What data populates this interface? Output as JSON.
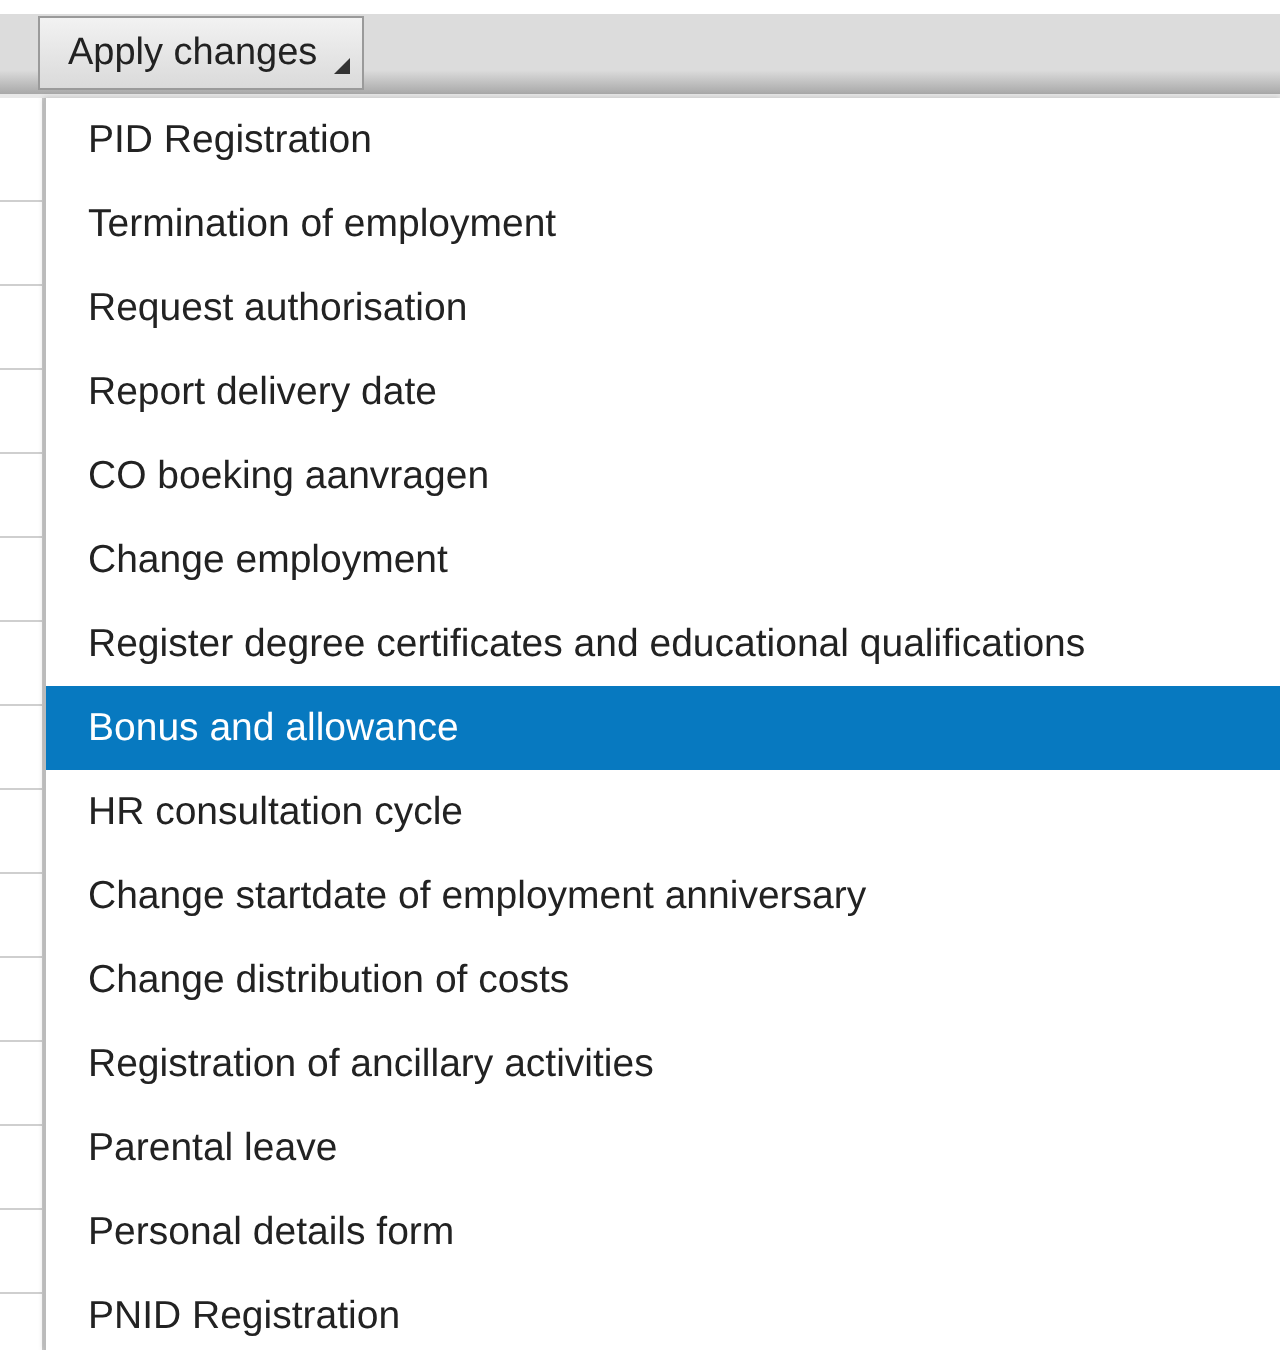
{
  "toolbar": {
    "button": {
      "label": "Apply changes"
    }
  },
  "menu": {
    "items": [
      {
        "label": "PID Registration",
        "selected": false
      },
      {
        "label": "Termination of employment",
        "selected": false
      },
      {
        "label": "Request authorisation",
        "selected": false
      },
      {
        "label": "Report delivery date",
        "selected": false
      },
      {
        "label": "CO boeking aanvragen",
        "selected": false
      },
      {
        "label": "Change employment",
        "selected": false
      },
      {
        "label": "Register degree certificates and educational qualifications",
        "selected": false
      },
      {
        "label": "Bonus and allowance",
        "selected": true
      },
      {
        "label": "HR consultation cycle",
        "selected": false
      },
      {
        "label": "Change startdate of employment anniversary",
        "selected": false
      },
      {
        "label": "Change distribution of costs",
        "selected": false
      },
      {
        "label": "Registration of ancillary activities",
        "selected": false
      },
      {
        "label": "Parental leave",
        "selected": false
      },
      {
        "label": "Personal details form",
        "selected": false
      },
      {
        "label": "PNID Registration",
        "selected": false
      }
    ]
  }
}
